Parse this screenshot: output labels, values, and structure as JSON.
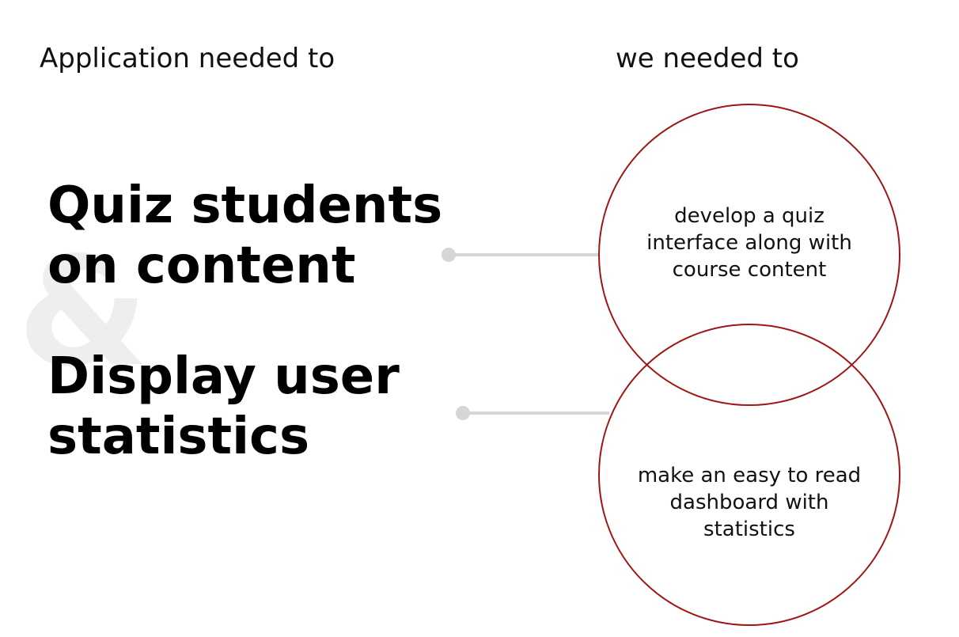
{
  "headings": {
    "left": "Application needed to",
    "right": "we needed to"
  },
  "ampersand": "&",
  "goals": [
    {
      "title": "Quiz students on content",
      "solution": "develop a quiz interface along with course content"
    },
    {
      "title": "Display user statistics",
      "solution": "make an easy to read dashboard with statistics"
    }
  ],
  "colors": {
    "circle_stroke": "#a01414",
    "connector": "#d6d6d6",
    "ampersand": "#eeeeee",
    "text": "#111111"
  }
}
